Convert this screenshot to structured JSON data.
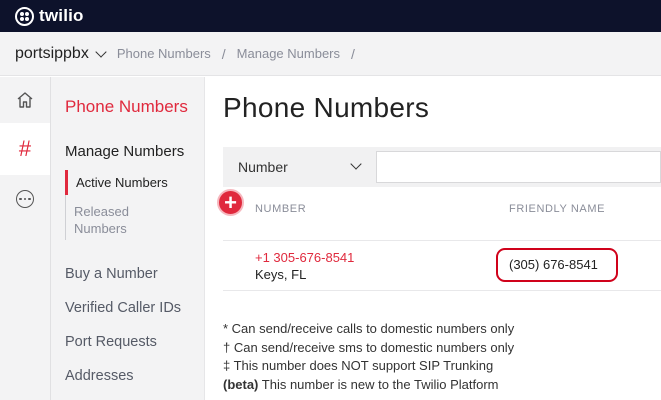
{
  "brand": {
    "logo_text": "twilio"
  },
  "breadcrumb": {
    "account": "portsippbx",
    "items": [
      "Phone Numbers",
      "Manage Numbers"
    ],
    "separator": "/"
  },
  "rail": {
    "icons": [
      "home-icon",
      "hash-icon",
      "more-icon"
    ],
    "hash_glyph": "#"
  },
  "subnav": {
    "title": "Phone Numbers",
    "manage": "Manage Numbers",
    "active_item": "Active Numbers",
    "released_line1": "Released",
    "released_line2": "Numbers",
    "links": [
      "Buy a Number",
      "Verified Caller IDs",
      "Port Requests",
      "Addresses"
    ]
  },
  "main": {
    "title": "Phone Numbers",
    "filter_select": "Number",
    "filter_input_value": "",
    "add_glyph": "+",
    "columns": [
      "NUMBER",
      "FRIENDLY NAME"
    ],
    "rows": [
      {
        "number": "+1 305-676-8541",
        "location": "Keys, FL",
        "friendly_name": "(305) 676-8541"
      }
    ],
    "legend": {
      "line1": "* Can send/receive calls to domestic numbers only",
      "line2": "† Can send/receive sms to domestic numbers only",
      "line3": "‡ This number does NOT support SIP Trunking",
      "line4_bold": "(beta)",
      "line4_rest": " This number is new to the Twilio Platform"
    }
  },
  "colors": {
    "accent": "#e0293d",
    "topbar": "#0d122b",
    "nav_bg": "#f3f3f4"
  }
}
